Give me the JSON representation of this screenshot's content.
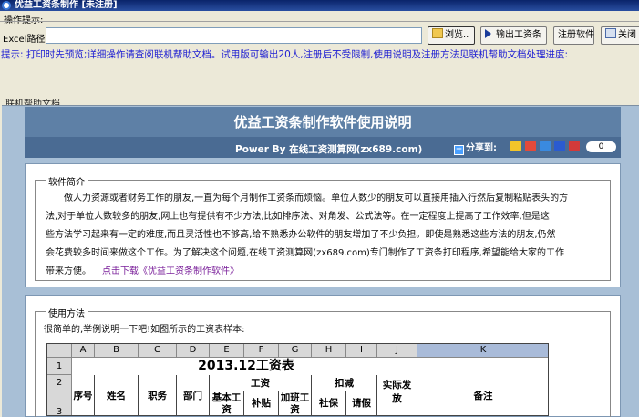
{
  "window": {
    "title": "优益工资条制作 [未注册]"
  },
  "ops": {
    "label": "操作提示:"
  },
  "excel": {
    "label": "Excel路径",
    "value": ""
  },
  "buttons": {
    "browse": "浏览..",
    "export": "输出工资条",
    "register": "注册软件",
    "close": "关闭"
  },
  "hint": {
    "text": "提示: 打印时先预览;详细操作请查阅联机帮助文档。试用版可输出20人,注册后不受限制,使用说明及注册方法见联机帮助文档处理进度:"
  },
  "help_tab": {
    "label": "联机帮助文档"
  },
  "doc": {
    "title": "优益工资条制作软件使用说明",
    "powerby": "Power By 在线工资测算网(zx689.com)",
    "share_label": "分享到:",
    "share_count": "0",
    "colors": {
      "header": "#5e80a6",
      "subheader": "#4a6b93",
      "frame": "#a8bfd6",
      "link": "#7a1f9a",
      "hint": "#1e1ed2"
    },
    "share_icons": [
      "star-icon",
      "share-site-icon",
      "qzone-icon",
      "person-icon",
      "weibo-icon"
    ]
  },
  "intro": {
    "legend": "软件简介",
    "lines": [
      "做人力资源或者财务工作的朋友,一直为每个月制作工资条而烦恼。单位人数少的朋友可以直接用插入行然后复制粘贴表头的方",
      "法,对于单位人数较多的朋友,网上也有提供有不少方法,比如排序法、对角发、公式法等。在一定程度上提高了工作效率,但是这",
      "些方法学习起来有一定的难度,而且灵活性也不够高,给不熟悉办公软件的朋友增加了不少负担。即使是熟悉这些方法的朋友,仍然",
      "会花费较多时间来做这个工作。为了解决这个问题,在线工资测算网(zx689.com)专门制作了工资条打印程序,希望能给大家的工作"
    ],
    "last_line": "带来方便。",
    "download_link": "点击下载《优益工资条制作软件》"
  },
  "usage": {
    "legend": "使用方法",
    "text": "很简单的,举例说明一下吧!如图所示的工资表样本:"
  },
  "sheet": {
    "columns": [
      "A",
      "B",
      "C",
      "D",
      "E",
      "F",
      "G",
      "H",
      "I",
      "J",
      "K"
    ],
    "rows": [
      "1",
      "2",
      "3"
    ],
    "title": "2013.12工资表",
    "headers": {
      "seq": "序号",
      "name": "姓名",
      "position": "职务",
      "dept": "部门",
      "salary_group": "工资",
      "base": "基本工资",
      "subsidy": "补贴",
      "overtime": "加班工资",
      "deduct_group": "扣减",
      "insurance": "社保",
      "leave": "请假",
      "actual": "实际发放",
      "remark": "备注"
    }
  }
}
